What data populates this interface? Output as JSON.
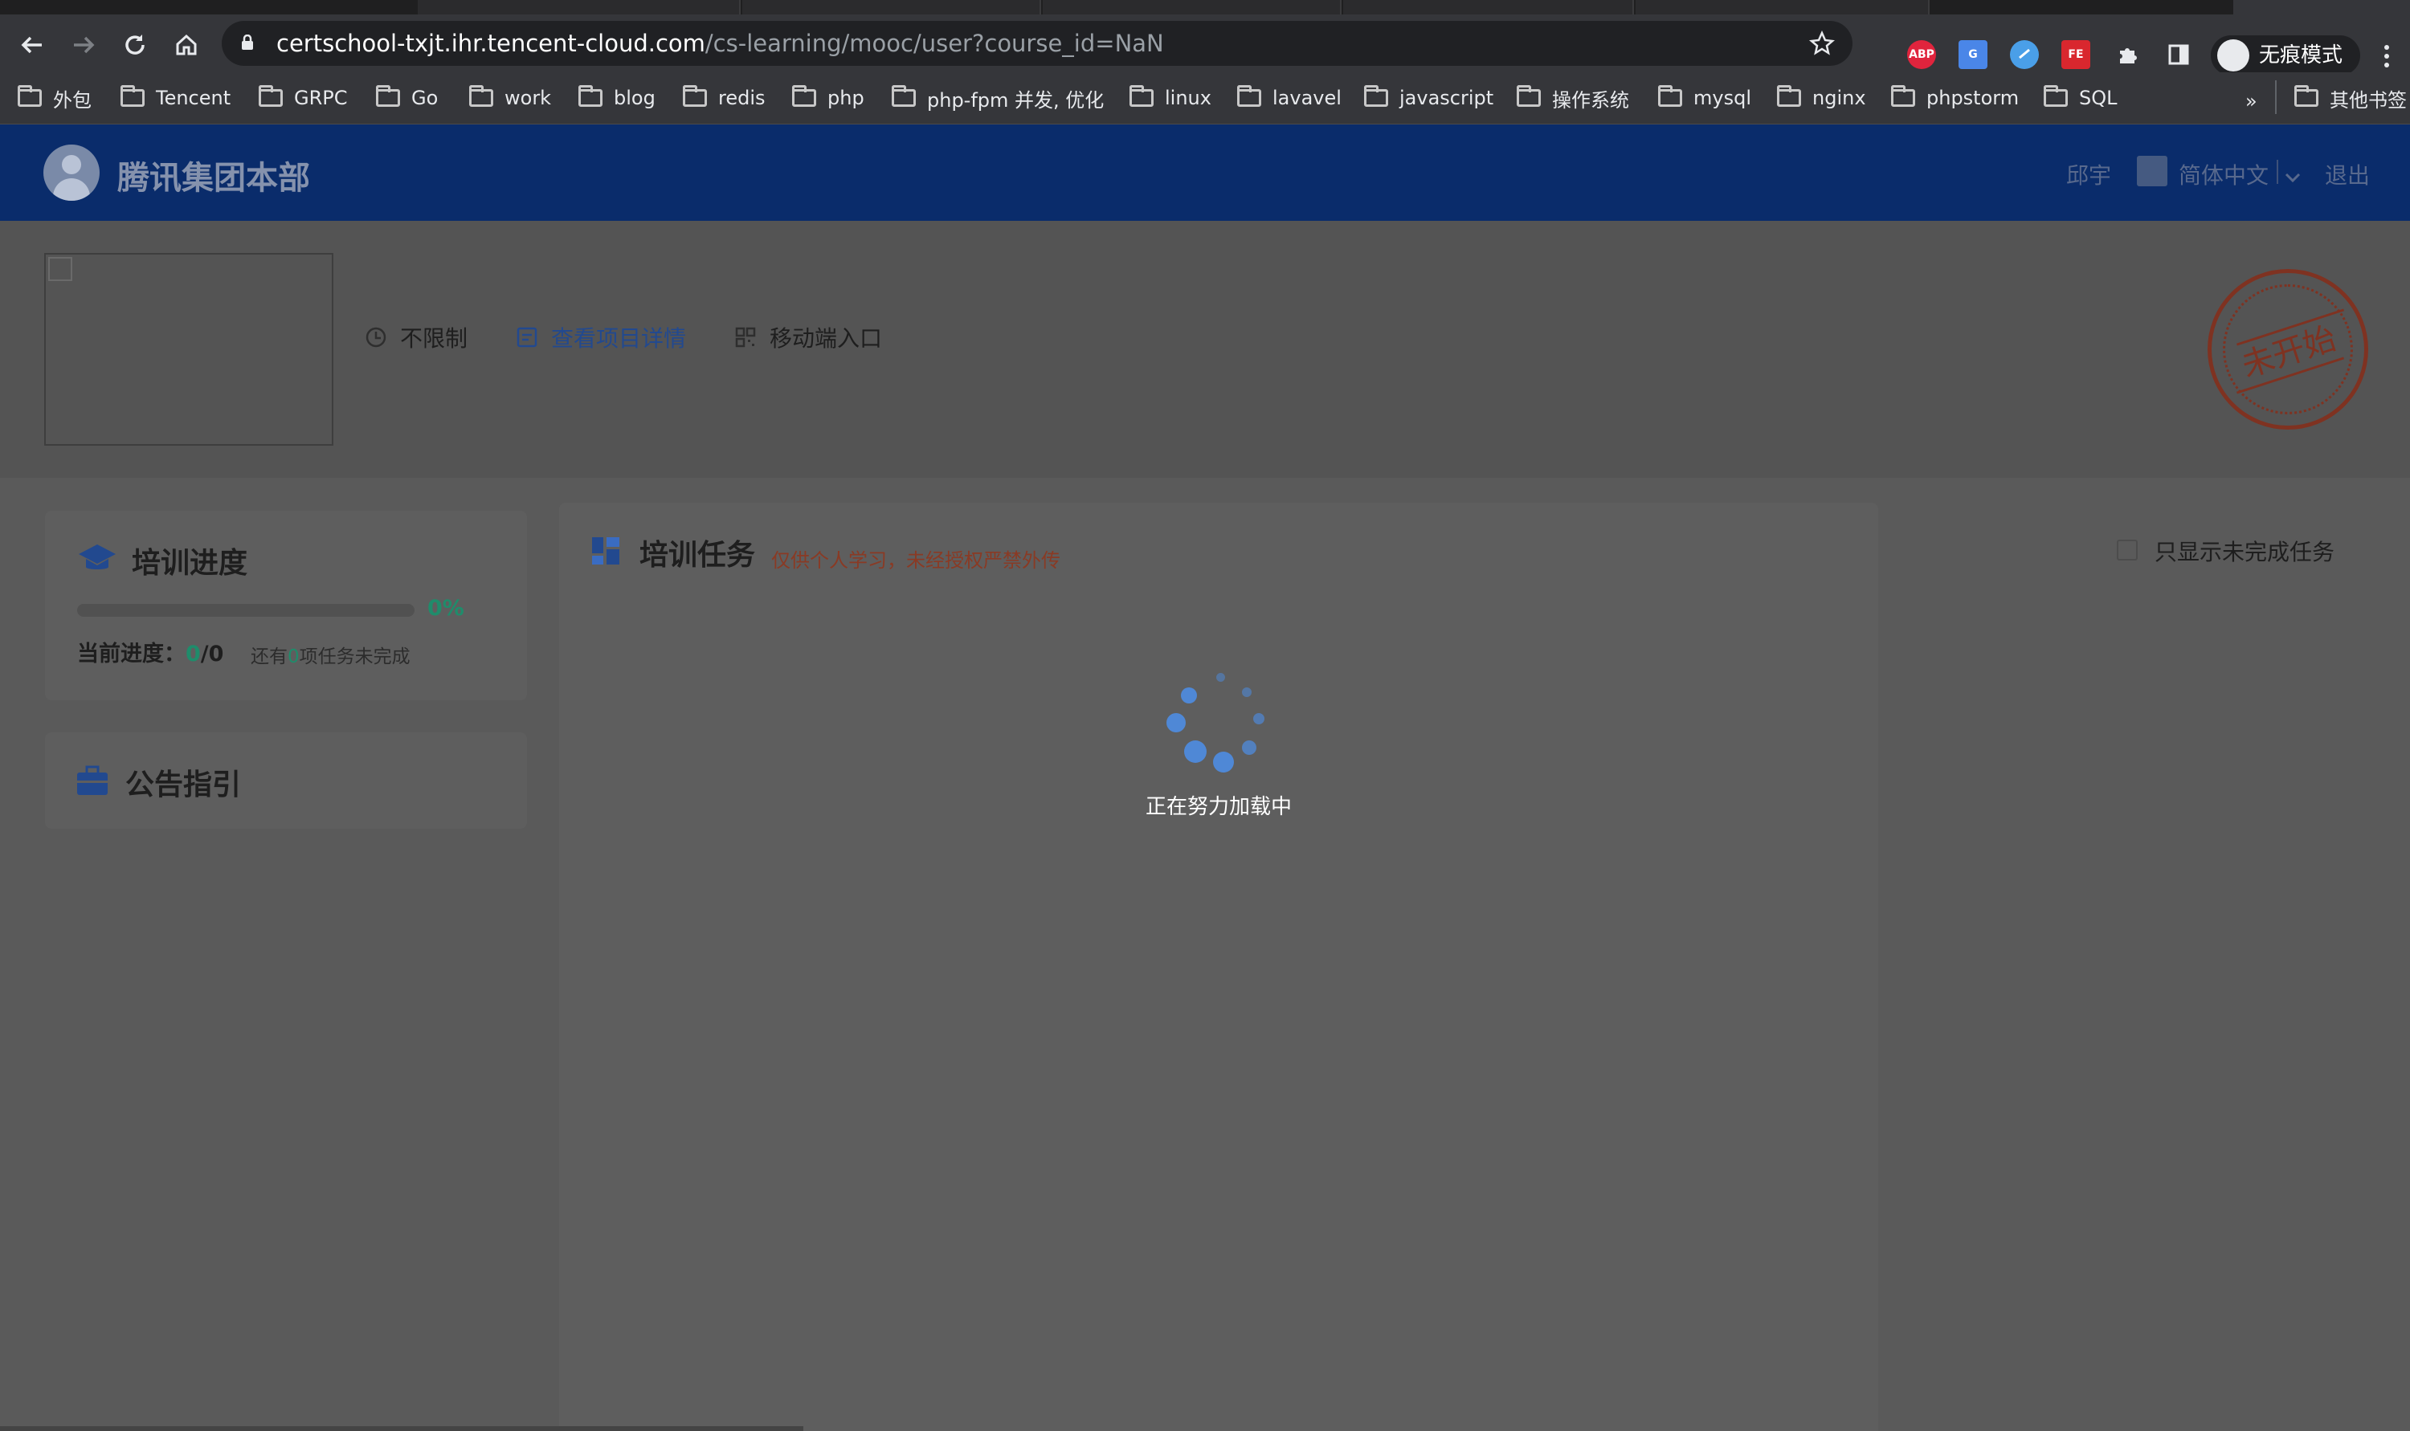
{
  "browser": {
    "url_host": "certschool-txjt.ihr.tencent-cloud.com",
    "url_path": "/cs-learning/mooc/user?course_id=NaN",
    "incognito_label": "无痕模式",
    "extensions": [
      {
        "name": "adblock-plus-icon",
        "text": "ABP",
        "color": "#e0243d"
      },
      {
        "name": "google-translate-icon",
        "text": "G",
        "color": "#4a86e8"
      },
      {
        "name": "vimium-icon",
        "text": "",
        "color": "#4a9fe8"
      },
      {
        "name": "fe-helper-icon",
        "text": "FE",
        "color": "#d9272e"
      }
    ],
    "bookmarks": [
      "外包",
      "Tencent",
      "GRPC",
      "Go",
      "work",
      "blog",
      "redis",
      "php",
      "php-fpm 并发, 优化",
      "linux",
      "lavavel",
      "javascript",
      "操作系统",
      "mysql",
      "nginx",
      "phpstorm",
      "SQL"
    ],
    "overflow_chevron": "»",
    "other_bookmarks": "其他书签"
  },
  "header": {
    "org_name": "腾讯集团本部",
    "user_name": "邱宇",
    "language": "简体中文",
    "logout": "退出"
  },
  "project": {
    "time_limit": "不限制",
    "view_details": "查看项目详情",
    "mobile_entry": "移动端入口",
    "stamp": "未开始"
  },
  "progress_card": {
    "title": "培训进度",
    "percent": "0%",
    "percent_value": 0,
    "current_label": "当前进度：",
    "done": "0",
    "slash": "/",
    "total": "0",
    "remain_prefix": "还有",
    "remain_count": "0",
    "remain_suffix": "项任务未完成"
  },
  "notice_card": {
    "title": "公告指引"
  },
  "tasks": {
    "title": "培训任务",
    "warning": "仅供个人学习，未经授权严禁外传",
    "filter_label": "只显示未完成任务",
    "loading": "正在努力加载中"
  },
  "colors": {
    "header_bg": "#0a2c6b",
    "accent_green": "#1f8c6b",
    "stamp_red": "#7f3221",
    "loader_blue": "#4f88d6"
  }
}
